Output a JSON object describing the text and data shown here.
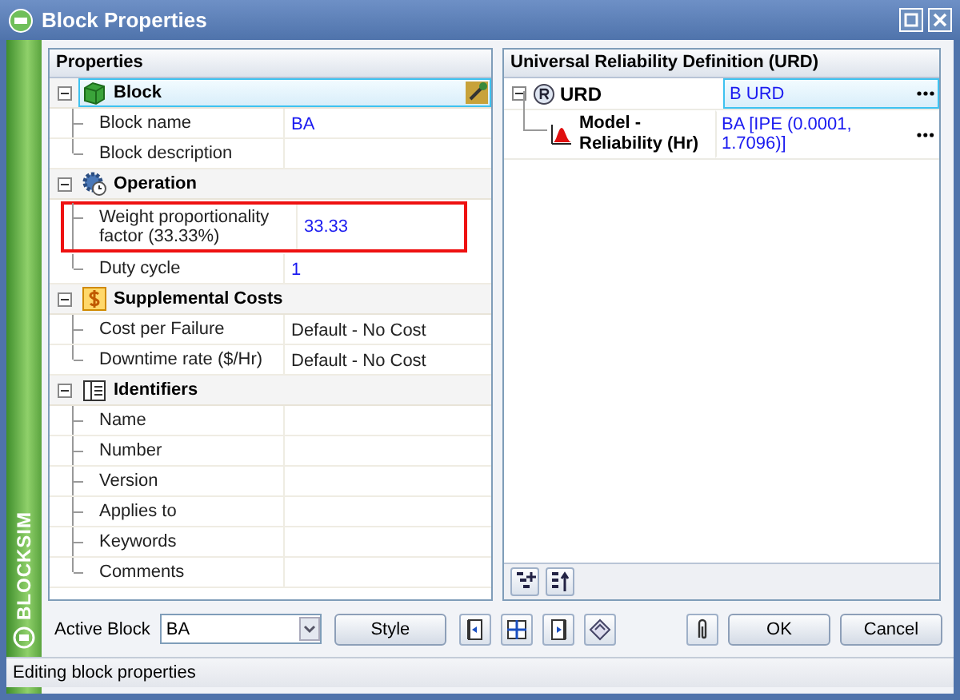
{
  "window": {
    "title": "Block Properties"
  },
  "brand": "BLOCKSIM",
  "properties": {
    "title": "Properties",
    "categories": [
      {
        "name": "Block",
        "kind": "block",
        "expanded": true,
        "selected": true,
        "rows": [
          {
            "label": "Block name",
            "value": "BA",
            "default": false,
            "highlighted": false
          },
          {
            "label": "Block description",
            "highlighted": false
          }
        ]
      },
      {
        "name": "Operation",
        "kind": "operation",
        "expanded": true,
        "selected": false,
        "rows": [
          {
            "label": "Weight proportionality factor (33.33%)",
            "value": "33.33",
            "default": false,
            "highlighted": true
          },
          {
            "label": "Duty cycle",
            "value": "1",
            "default": false,
            "highlighted": false
          }
        ]
      },
      {
        "name": "Supplemental Costs",
        "kind": "costs",
        "expanded": true,
        "selected": false,
        "rows": [
          {
            "label": "Cost per Failure",
            "value": "Default - No Cost",
            "default": true,
            "highlighted": false
          },
          {
            "label": "Downtime rate ($/Hr)",
            "value": "Default - No Cost",
            "default": true,
            "highlighted": false
          }
        ]
      },
      {
        "name": "Identifiers",
        "kind": "identifiers",
        "expanded": true,
        "selected": false,
        "rows": [
          {
            "label": "Name",
            "highlighted": false
          },
          {
            "label": "Number",
            "highlighted": false
          },
          {
            "label": "Version",
            "highlighted": false
          },
          {
            "label": "Applies to",
            "highlighted": false
          },
          {
            "label": "Keywords",
            "highlighted": false
          },
          {
            "label": "Comments",
            "highlighted": false
          }
        ]
      }
    ]
  },
  "urd": {
    "title": "Universal Reliability Definition (URD)",
    "tree": [
      {
        "label": "URD",
        "value": "B URD",
        "selected": true,
        "expanded": true,
        "children": [
          {
            "label": "Model - Reliability (Hr)",
            "value": "BA [IPE (0.0001, 1.7096)]",
            "selected": false
          }
        ]
      }
    ]
  },
  "active_block": {
    "label": "Active Block",
    "value": "BA"
  },
  "style_button": "Style",
  "ok_button": "OK",
  "cancel_button": "Cancel",
  "status_bar": "Editing block properties"
}
